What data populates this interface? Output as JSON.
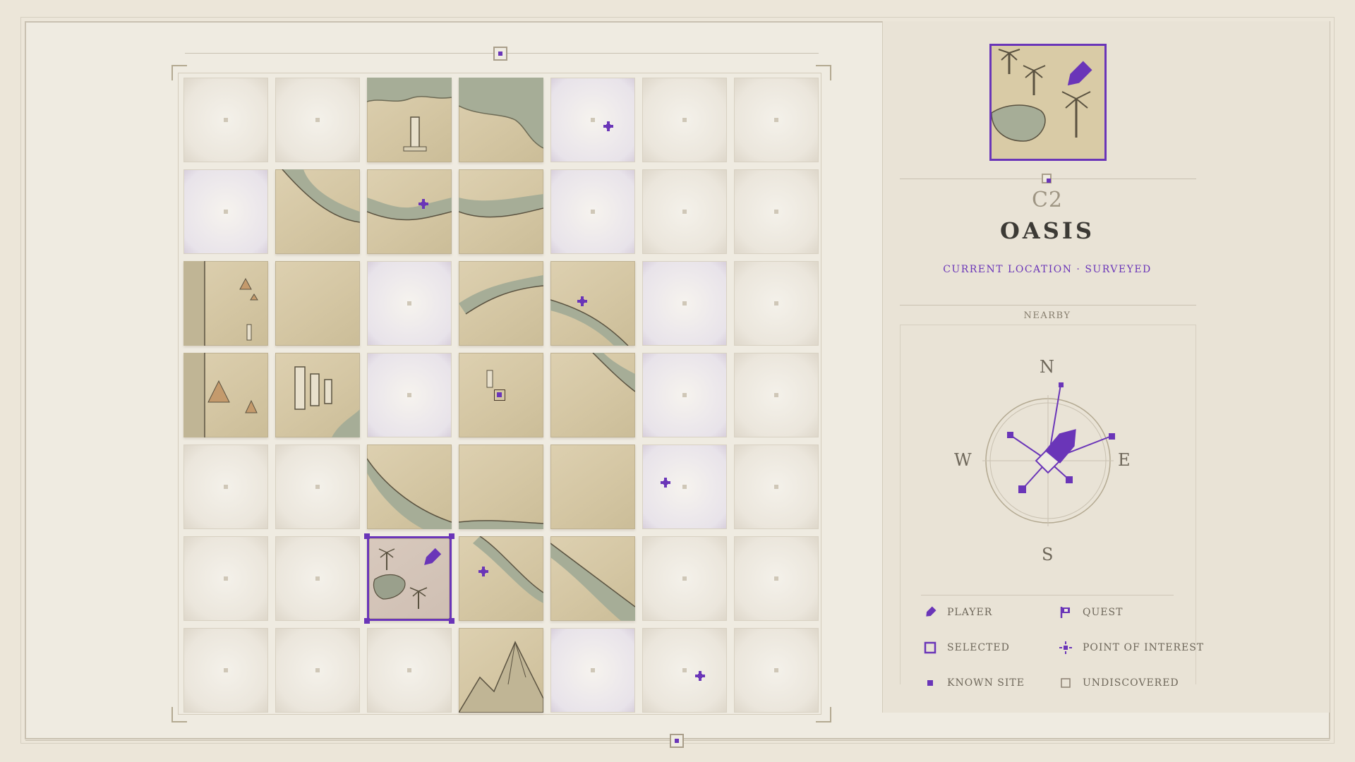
{
  "map": {
    "rows": [
      [
        "undiscovered",
        "undiscovered",
        "surveyed",
        "surveyed",
        "undiscovered",
        "undiscovered",
        "undiscovered"
      ],
      [
        "undiscovered",
        "surveyed",
        "surveyed",
        "surveyed",
        "undiscovered",
        "undiscovered",
        "undiscovered"
      ],
      [
        "surveyed",
        "surveyed",
        "undiscovered",
        "surveyed",
        "surveyed",
        "undiscovered",
        "undiscovered"
      ],
      [
        "surveyed",
        "surveyed",
        "undiscovered",
        "surveyed",
        "surveyed",
        "undiscovered",
        "undiscovered"
      ],
      [
        "undiscovered",
        "undiscovered",
        "surveyed",
        "surveyed",
        "surveyed",
        "undiscovered",
        "undiscovered"
      ],
      [
        "undiscovered",
        "undiscovered",
        "selected",
        "surveyed",
        "surveyed",
        "undiscovered",
        "undiscovered"
      ],
      [
        "undiscovered",
        "undiscovered",
        "undiscovered",
        "surveyed",
        "undiscovered",
        "undiscovered",
        "undiscovered"
      ]
    ],
    "selected_cell": "C2",
    "accent_color": "#6a35b8"
  },
  "location": {
    "coordinate": "C2",
    "name": "OASIS",
    "status": "CURRENT LOCATION · SURVEYED"
  },
  "nearby": {
    "label": "NEARBY",
    "directions": {
      "n": "N",
      "e": "E",
      "s": "S",
      "w": "W"
    }
  },
  "legend": {
    "player": "PLAYER",
    "quest": "QUEST",
    "selected": "SELECTED",
    "poi": "POINT OF INTEREST",
    "known_site": "KNOWN SITE",
    "undiscovered": "UNDISCOVERED"
  }
}
